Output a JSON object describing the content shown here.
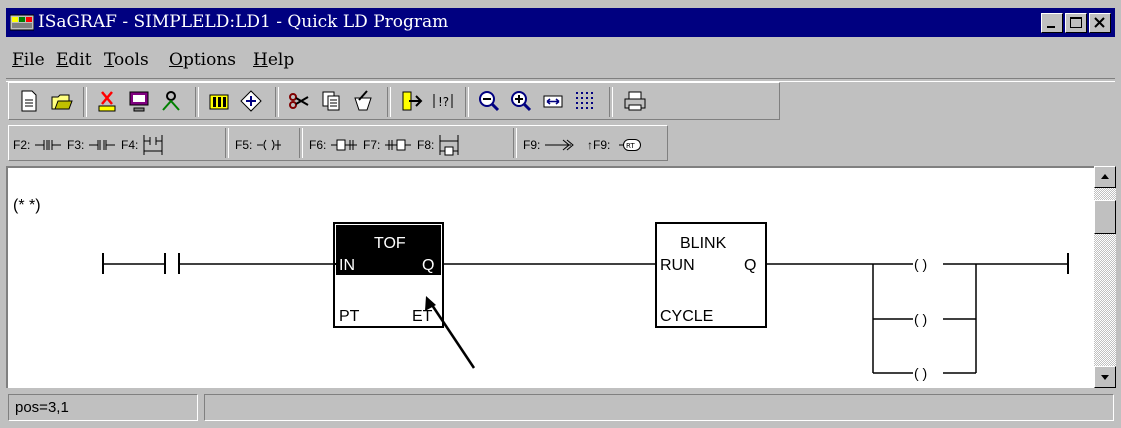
{
  "window": {
    "title": "ISaGRAF - SIMPLELD:LD1 - Quick LD Program",
    "controls": [
      "minimize-icon",
      "maximize-icon",
      "close-icon"
    ]
  },
  "menu": [
    {
      "label": "File"
    },
    {
      "label": "Edit"
    },
    {
      "label": "Tools"
    },
    {
      "label": "Options"
    },
    {
      "label": "Help"
    }
  ],
  "toolbar_icons": [
    "new-document-icon",
    "open-folder-icon",
    "cut-program-icon",
    "monitor-icon",
    "search-person-icon",
    "dictionary-icon",
    "variables-icon",
    "cut-icon",
    "copy-icon",
    "paste-icon",
    "jump-icon",
    "comment-icon",
    "zoom-out-icon",
    "zoom-in-icon",
    "resize-icon",
    "grid-icon",
    "print-icon"
  ],
  "fkeys": {
    "f2": "F2:",
    "f3": "F3:",
    "f4": "F4:",
    "f5": "F5:",
    "f6": "F6:",
    "f7": "F7:",
    "f8": "F8:",
    "f9": "F9:",
    "sf9": "↑F9:"
  },
  "diagram": {
    "comment": "(* *)",
    "tof": {
      "name": "TOF",
      "in": "IN",
      "q": "Q",
      "pt": "PT",
      "et": "ET"
    },
    "blink": {
      "name": "BLINK",
      "run": "RUN",
      "q": "Q",
      "cycle": "CYCLE"
    },
    "coil_glyph": "( )"
  },
  "status": {
    "pos": "pos=3,1"
  }
}
